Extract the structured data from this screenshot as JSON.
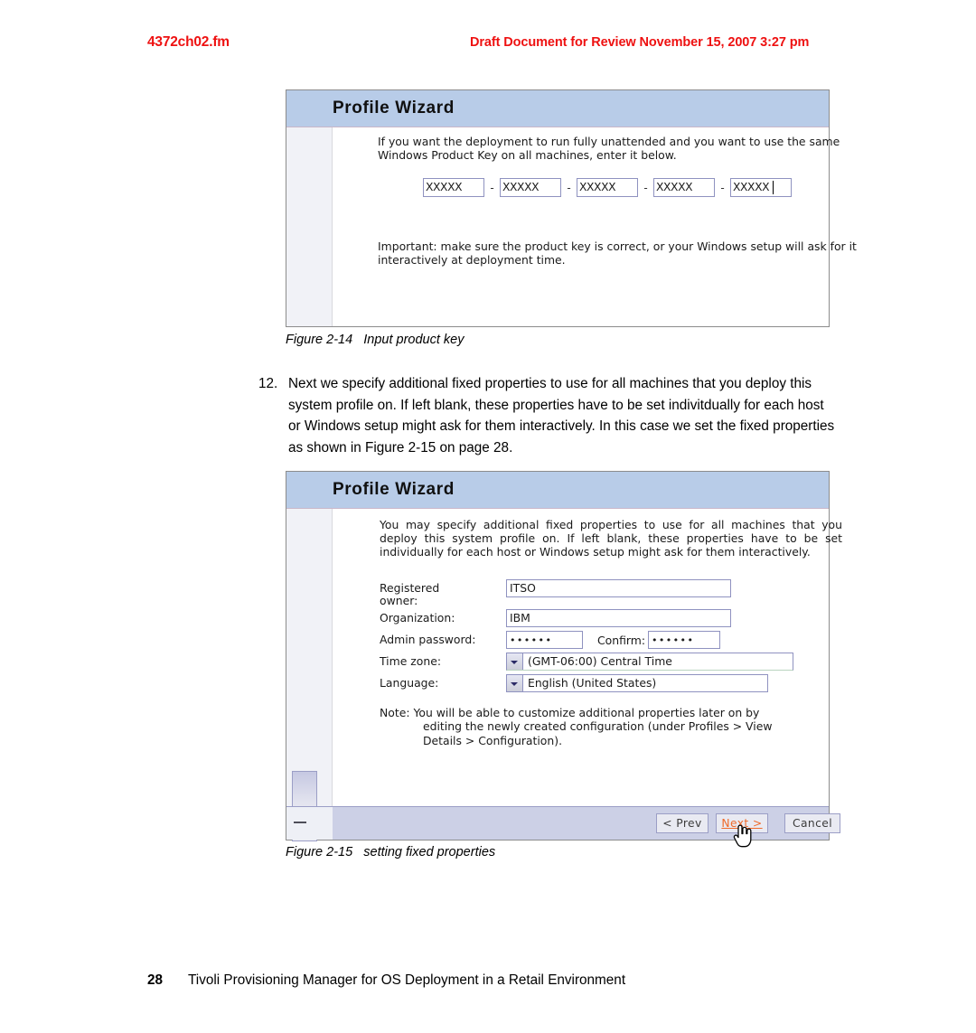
{
  "page": {
    "running_header": {
      "file_name": "4372ch02.fm",
      "draft_notice": "Draft Document for Review November 15, 2007 3:27 pm"
    },
    "footer": {
      "page_number": "28",
      "book_title": "Tivoli Provisioning Manager for OS Deployment in a Retail Environment"
    }
  },
  "figure_2_14": {
    "caption_label": "Figure 2-14",
    "caption_text": "Input product key",
    "dialog": {
      "title": "Profile Wizard",
      "intro": "If you want the deployment to run fully unattended and you want to use the same Windows Product Key on all machines, enter it below.",
      "product_key_segments": [
        "XXXXX",
        "XXXXX",
        "XXXXX",
        "XXXXX",
        "XXXXX"
      ],
      "separator": "-",
      "important": "Important: make sure the product key is correct, or your Windows setup will ask for it interactively at deployment time."
    }
  },
  "body_step": {
    "number": "12.",
    "text": "Next we specify additional fixed properties to use for all machines that you deploy this system profile on. If left blank, these properties have to be set indivitdually for each host or Windows setup might ask for them interactively. In this case we set the fixed properties as shown in Figure 2-15 on page 28."
  },
  "figure_2_15": {
    "caption_label": "Figure 2-15",
    "caption_text": "setting fixed properties",
    "dialog": {
      "title": "Profile Wizard",
      "intro": "You may specify additional fixed properties to use for all machines that you deploy this system profile on. If left blank, these properties have to be set individually for each host or Windows setup might ask for them interactively.",
      "fields": {
        "registered_owner_label": "Registered\nowner:",
        "registered_owner_value": "ITSO",
        "organization_label": "Organization:",
        "organization_value": "IBM",
        "admin_password_label": "Admin password:",
        "admin_password_value": "••••••",
        "confirm_label": "Confirm:",
        "confirm_value": "••••••",
        "time_zone_label": "Time zone:",
        "time_zone_value": "(GMT-06:00) Central Time",
        "language_label": "Language:",
        "language_value": "English (United States)"
      },
      "note_line1": "Note: You will be able to customize additional properties later on by",
      "note_line2": "editing the newly created configuration (under Profiles > View",
      "note_line3": "Details > Configuration).",
      "buttons": {
        "prev": "< Prev",
        "next": "Next >",
        "cancel": "Cancel"
      }
    }
  },
  "colors": {
    "header_red": "#ee1111",
    "title_bar_blue": "#b8cce8",
    "input_border": "#8f92c0",
    "button_bar": "#ccd0e6",
    "hover_link_orange": "#ef6a2a"
  }
}
